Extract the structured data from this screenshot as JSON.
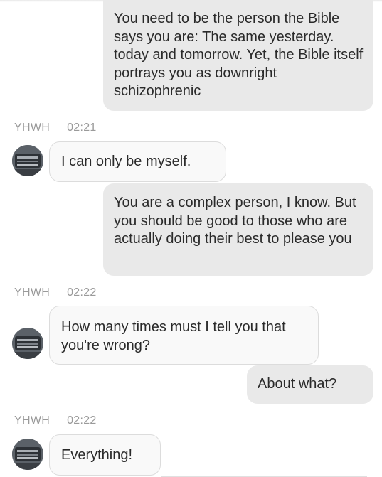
{
  "messages": [
    {
      "type": "out",
      "text": "You need to be the person the Bible says you are: The same yesterday. today and tomorrow. Yet, the Bible itself portrays you as downright schizophrenic"
    },
    {
      "type": "meta",
      "sender": "YHWH",
      "time": "02:21"
    },
    {
      "type": "in",
      "text": "I can only be myself.",
      "avatar": "yhwh-avatar"
    },
    {
      "type": "out",
      "text": "You are a complex person, I know. But you should be good to those who are actually doing their best to please you"
    },
    {
      "type": "meta",
      "sender": "YHWH",
      "time": "02:22"
    },
    {
      "type": "in",
      "text": "How many times must I tell you that you're wrong?",
      "avatar": "yhwh-avatar"
    },
    {
      "type": "out",
      "text": "About what?"
    },
    {
      "type": "meta",
      "sender": "YHWH",
      "time": "02:22"
    },
    {
      "type": "in",
      "text": "Everything!",
      "avatar": "yhwh-avatar"
    }
  ],
  "colors": {
    "outgoing_bubble": "#e9e9e9",
    "incoming_bubble": "#f9f9f9",
    "incoming_border": "#dcdcdc",
    "meta_text": "#9a9a9a",
    "message_text": "#2a2a2a"
  }
}
